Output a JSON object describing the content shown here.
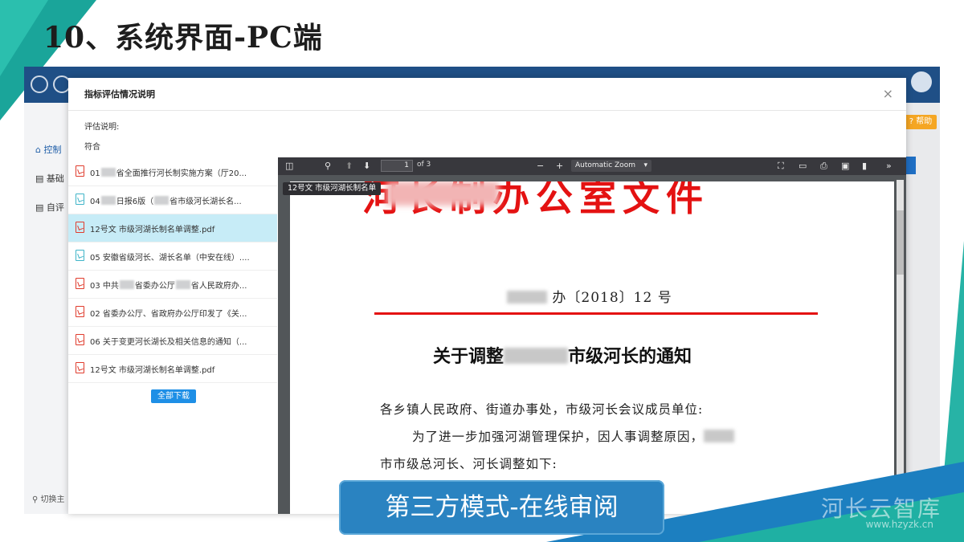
{
  "slide": {
    "title": "10、系统界面-PC端",
    "banner": "第三方模式-在线审阅",
    "watermark": "河长云智库",
    "watermark_url": "www.hzyzk.cn"
  },
  "app": {
    "sidebar": [
      {
        "label": "控制",
        "icon": "home-icon"
      },
      {
        "label": "基础",
        "icon": "doc-icon"
      },
      {
        "label": "自评",
        "icon": "doc-icon"
      }
    ],
    "sidebar_bottom": "切换主",
    "help_label": "帮助"
  },
  "dialog": {
    "title": "指标评估情况说明",
    "close": "×",
    "eval_label": "评估说明:",
    "eval_value": "符合",
    "download_all": "全部下载",
    "files": [
      {
        "pre": "01",
        "post": "省全面推行河长制实施方案（厅20...",
        "type": "pdf",
        "active": false
      },
      {
        "pre": "04",
        "mid": "日报6版（",
        "post": "省市级河长湖长名...",
        "type": "doc",
        "active": false
      },
      {
        "pre": "12号文 市级河湖长制名单调整.pdf",
        "type": "pdf",
        "active": true
      },
      {
        "pre": "05 安徽省级河长、湖长名单（中安在线）....",
        "type": "doc",
        "active": false
      },
      {
        "pre": "03 中共",
        "mid": "省委办公厅",
        "post": "省人民政府办...",
        "type": "pdf",
        "active": false
      },
      {
        "pre": "02 省委办公厅、省政府办公厅印发了《关...",
        "type": "pdf",
        "active": false
      },
      {
        "pre": "06 关于变更河长湖长及相关信息的通知（...",
        "type": "pdf",
        "active": false
      },
      {
        "pre": "12号文 市级河湖长制名单调整.pdf",
        "type": "pdf",
        "active": false
      }
    ]
  },
  "pdf": {
    "page": "1",
    "of": "of 3",
    "zoom": "Automatic Zoom",
    "tooltip": "12号文 市级河湖长制名单",
    "doc_header": "河长制办公室文件",
    "doc_number_mid": "办〔2018〕12 号",
    "heading_pre": "关于调整",
    "heading_post": "市级河长的通知",
    "p1": "各乡镇人民政府、街道办事处，市级河长会议成员单位:",
    "p2": "为了进一步加强河湖管理保护，因人事调整原因，",
    "p3": "市市级总河长、河长调整如下:"
  }
}
